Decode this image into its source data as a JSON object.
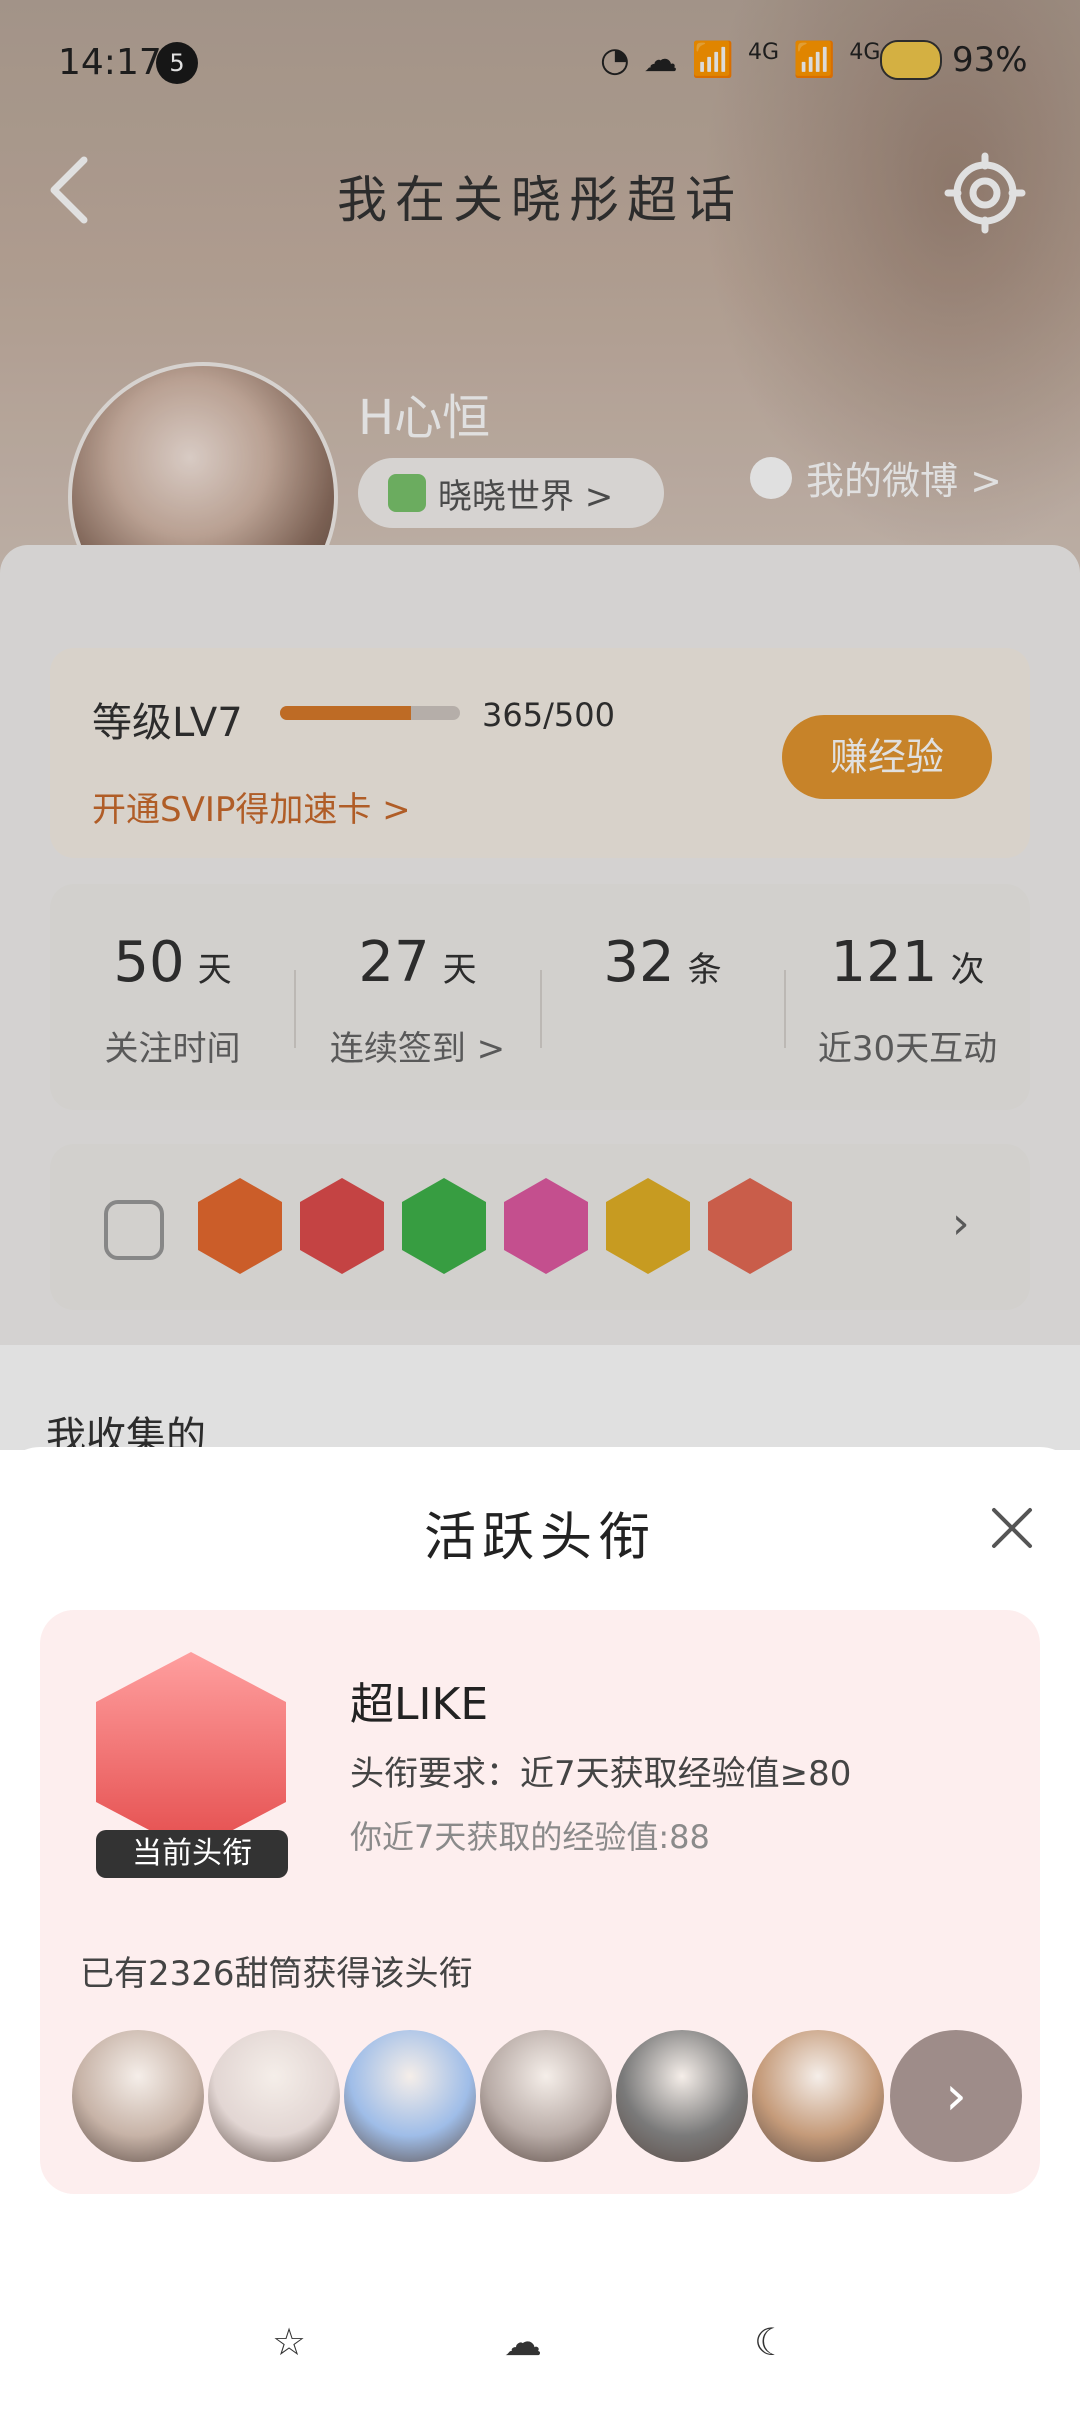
{
  "status": {
    "time": "14:17",
    "notification_count": "5",
    "network_labels": [
      "4G",
      "4G"
    ],
    "battery": "93%"
  },
  "nav": {
    "title": "我在关晓彤超话"
  },
  "profile": {
    "username": "H心恒",
    "world_chip": "晓晓世界 >",
    "my_weibo": "我的微博 >"
  },
  "level": {
    "title": "等级LV7",
    "progress_text": "365/500",
    "progress_fraction": 0.73,
    "svip_link": "开通SVIP得加速卡 >",
    "earn_button": "赚经验"
  },
  "stats": [
    {
      "num": "50",
      "unit": "天",
      "label": "关注时间"
    },
    {
      "num": "27",
      "unit": "天",
      "label": "连续签到 >"
    },
    {
      "num": "32",
      "unit": "条",
      "label": ""
    },
    {
      "num": "121",
      "unit": "次",
      "label": "近30天互动"
    }
  ],
  "medals": [
    {
      "name": "lv7-medal",
      "color": "#e86a2f"
    },
    {
      "name": "trophy-medal",
      "color": "#e04d4d"
    },
    {
      "name": "hand-medal",
      "color": "#3fb34b"
    },
    {
      "name": "grad-medal",
      "color": "#e05aa2"
    },
    {
      "name": "laugh-medal",
      "color": "#e3b126"
    },
    {
      "name": "hand2-medal",
      "color": "#e56a55"
    }
  ],
  "collect": {
    "title": "我收集的"
  },
  "sheet": {
    "title": "活跃头衔",
    "badge_current": "当前头衔",
    "name": "超LIKE",
    "requirement": "头衔要求：近7天获取经验值≥80",
    "my_exp": "你近7天获取的经验值:88",
    "holder_count": "已有2326甜筒获得该头衔",
    "more": "›"
  },
  "holders": [
    {
      "color": "#c7b3a7"
    },
    {
      "color": "#e2d6d3"
    },
    {
      "color": "#9fbde8"
    },
    {
      "color": "#b8aba6"
    },
    {
      "color": "#7a7a7a"
    },
    {
      "color": "#c59b7a"
    }
  ]
}
